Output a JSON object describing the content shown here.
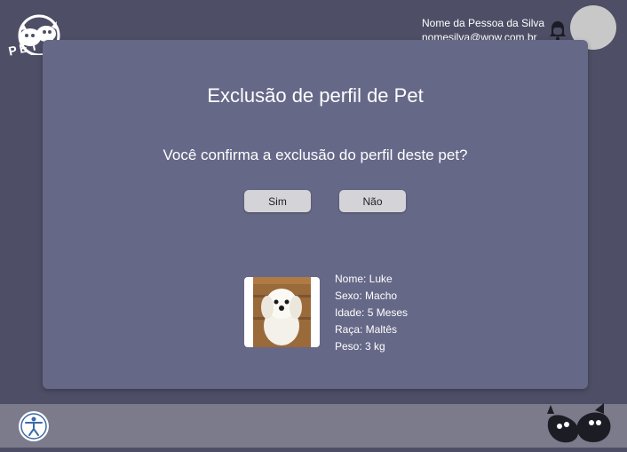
{
  "brand": {
    "logo_text": "PET P"
  },
  "user": {
    "name": "Nome da Pessoa da Silva",
    "email": "nomesilva@wow.com.br"
  },
  "icons": {
    "notifications": "bell-icon",
    "accessibility": "accessibility-icon",
    "footer_logo": "pets-logo-icon"
  },
  "modal": {
    "title": "Exclusão de perfil de Pet",
    "question": "Você confirma a exclusão do perfil deste pet?",
    "confirm_label": "Sim",
    "cancel_label": "Não"
  },
  "pet": {
    "name": "Nome: Luke",
    "sex": "Sexo: Macho",
    "age": "Idade: 5 Meses",
    "breed": "Raça: Maltês",
    "weight": "Peso: 3 kg"
  },
  "colors": {
    "background": "#4e4e66",
    "modal": "#666888",
    "bottom_bar": "#7b7b8b",
    "button": "#d4d4d8"
  }
}
